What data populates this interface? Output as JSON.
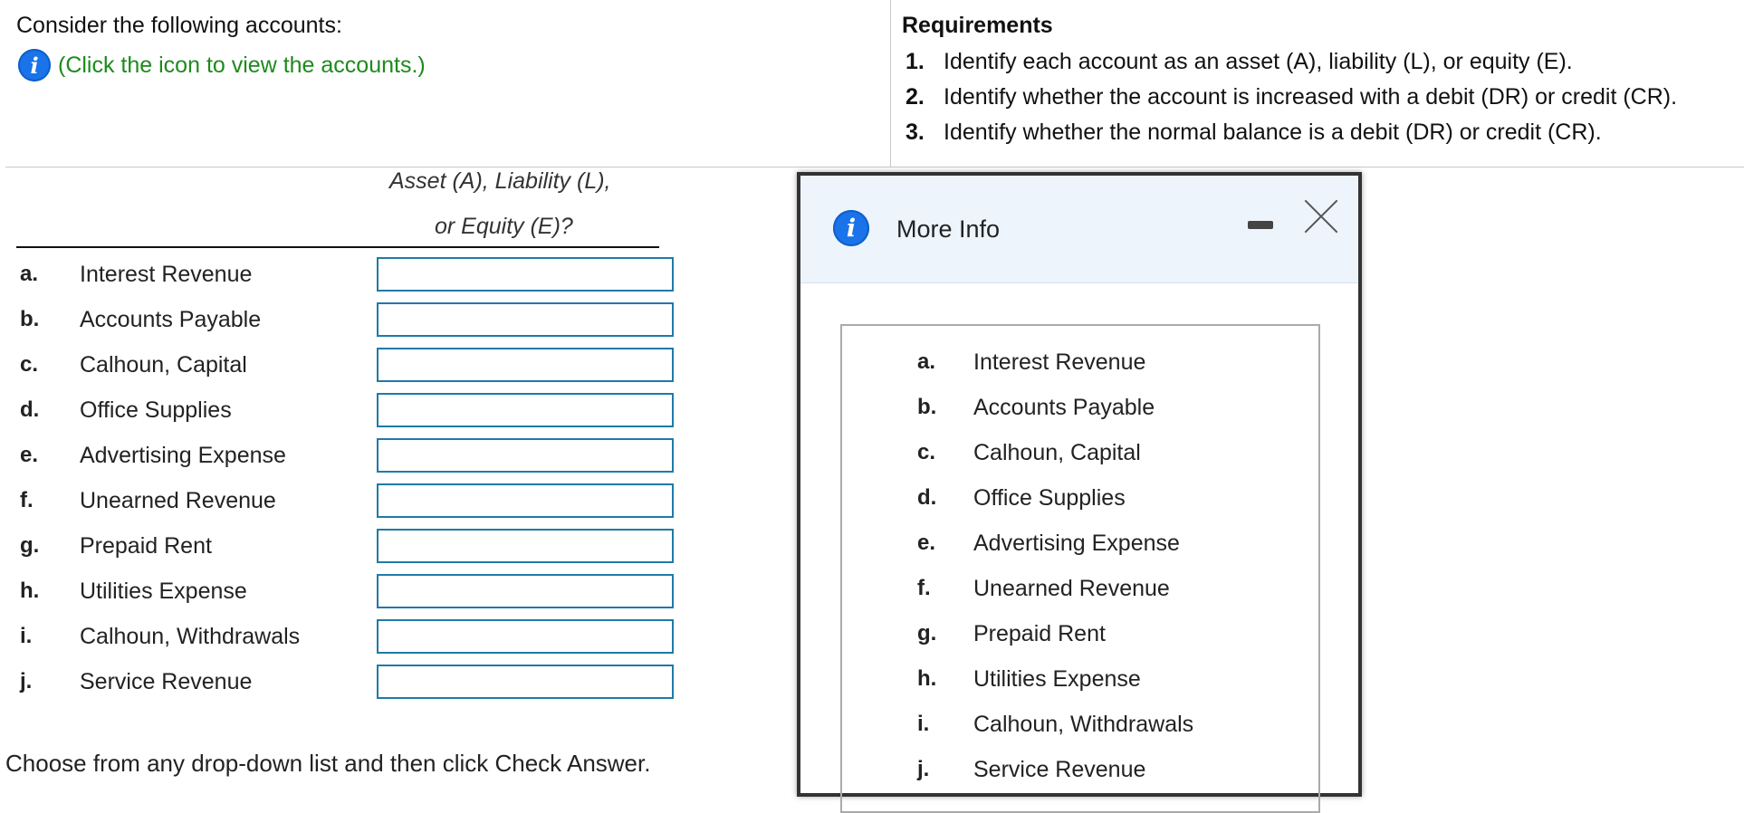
{
  "intro": {
    "text": "Consider the following accounts:",
    "info_link": "(Click the icon to view the accounts.)"
  },
  "requirements": {
    "title": "Requirements",
    "items": [
      {
        "num": "1.",
        "text": "Identify each account as an asset (A), liability (L), or equity (E)."
      },
      {
        "num": "2.",
        "text": "Identify whether the account is increased with a debit (DR) or credit (CR)."
      },
      {
        "num": "3.",
        "text": "Identify whether the normal balance is a debit (DR) or credit (CR)."
      }
    ]
  },
  "table": {
    "header_line1": "Asset (A), Liability (L),",
    "header_line2": "or Equity (E)?",
    "rows": [
      {
        "letter": "a.",
        "name": "Interest Revenue",
        "value": ""
      },
      {
        "letter": "b.",
        "name": "Accounts Payable",
        "value": ""
      },
      {
        "letter": "c.",
        "name": "Calhoun, Capital",
        "value": ""
      },
      {
        "letter": "d.",
        "name": "Office Supplies",
        "value": ""
      },
      {
        "letter": "e.",
        "name": "Advertising Expense",
        "value": ""
      },
      {
        "letter": "f.",
        "name": "Unearned Revenue",
        "value": ""
      },
      {
        "letter": "g.",
        "name": "Prepaid Rent",
        "value": ""
      },
      {
        "letter": "h.",
        "name": "Utilities Expense",
        "value": ""
      },
      {
        "letter": "i.",
        "name": "Calhoun, Withdrawals",
        "value": ""
      },
      {
        "letter": "j.",
        "name": "Service Revenue",
        "value": ""
      }
    ]
  },
  "footer": {
    "instruction": "Choose from any drop-down list and then click Check Answer."
  },
  "modal": {
    "title": "More Info",
    "accounts": [
      {
        "letter": "a.",
        "name": "Interest Revenue"
      },
      {
        "letter": "b.",
        "name": "Accounts Payable"
      },
      {
        "letter": "c.",
        "name": "Calhoun, Capital"
      },
      {
        "letter": "d.",
        "name": "Office Supplies"
      },
      {
        "letter": "e.",
        "name": "Advertising Expense"
      },
      {
        "letter": "f.",
        "name": "Unearned Revenue"
      },
      {
        "letter": "g.",
        "name": "Prepaid Rent"
      },
      {
        "letter": "h.",
        "name": "Utilities Expense"
      },
      {
        "letter": "i.",
        "name": "Calhoun, Withdrawals"
      },
      {
        "letter": "j.",
        "name": "Service Revenue"
      }
    ]
  },
  "icons": {
    "info": "info-icon",
    "minimize": "minimize-icon",
    "close": "close-icon"
  },
  "colors": {
    "link_green": "#1d8a1d",
    "info_blue": "#1a73e8",
    "input_border": "#1f7aa8"
  }
}
